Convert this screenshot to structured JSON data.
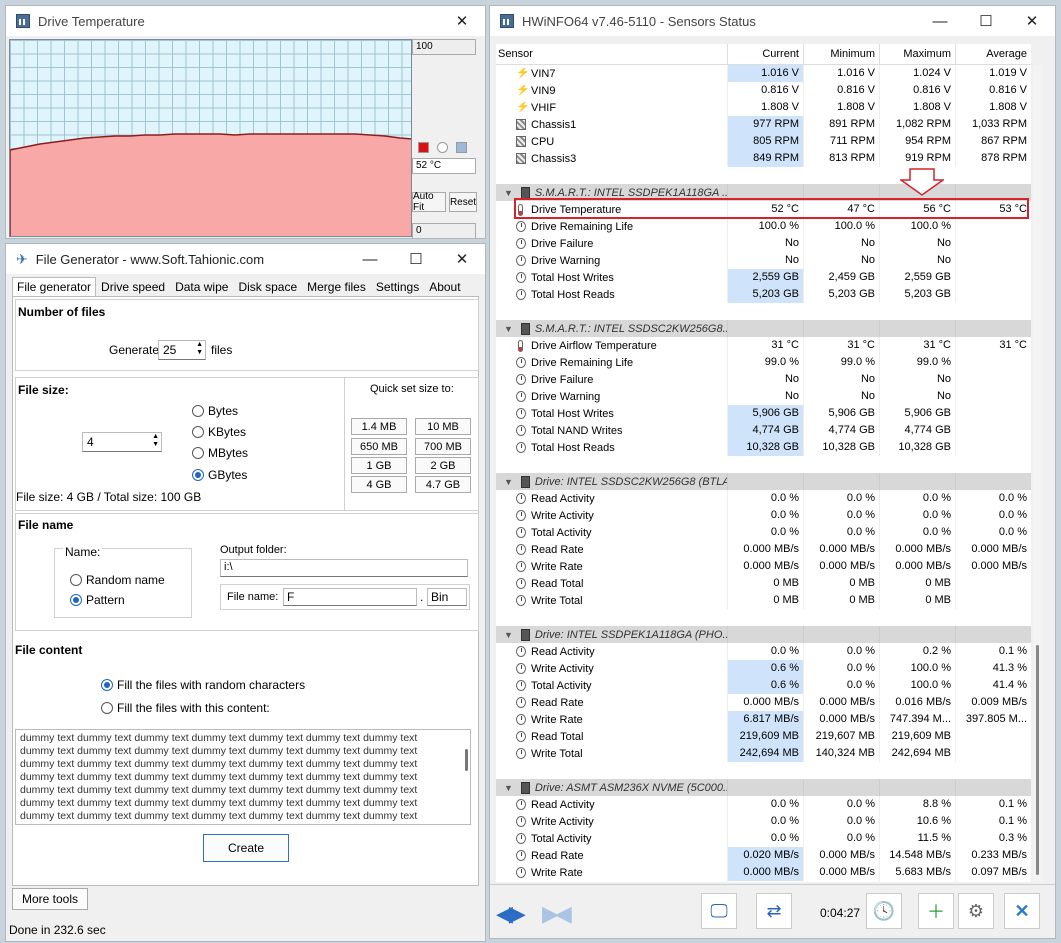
{
  "drive_temp_window": {
    "title": "Drive Temperature",
    "max_value": "100",
    "current_value": "52 °C",
    "min_value": "0",
    "auto_fit_label": "Auto Fit",
    "reset_label": "Reset",
    "fill_color": "#f9a8a8",
    "line_color": "#8b1d1d"
  },
  "file_generator": {
    "title": "File Generator  -  www.Soft.Tahionic.com",
    "tabs": [
      "File generator",
      "Drive speed",
      "Data wipe",
      "Disk space",
      "Merge files",
      "Settings",
      "About"
    ],
    "number_of_files": {
      "heading": "Number of files",
      "generate_label": "Generate",
      "count": "25",
      "files_label": "files"
    },
    "file_size": {
      "heading": "File size:",
      "value": "4",
      "units": [
        "Bytes",
        "KBytes",
        "MBytes",
        "GBytes"
      ],
      "selected_unit": "GBytes",
      "summary": "File size: 4 GB / Total size: 100 GB",
      "quick_set_label": "Quick set size to:",
      "quick_sizes": [
        "1.4 MB",
        "10 MB",
        "650 MB",
        "700 MB",
        "1 GB",
        "2 GB",
        "4 GB",
        "4.7 GB"
      ]
    },
    "file_name": {
      "heading": "File name",
      "name_label": "Name:",
      "random_name": "Random name",
      "pattern": "Pattern",
      "output_folder_label": "Output folder:",
      "output_folder": "i:\\",
      "file_name_label": "File name:",
      "file_name_value": "F",
      "ext_dot": ".",
      "extension": "Bin"
    },
    "file_content": {
      "heading": "File content",
      "option_random": "Fill the files with random characters",
      "option_content": "Fill the files with this content:",
      "content_lines": [
        "dummy text dummy text dummy text dummy text dummy text dummy text dummy text",
        "dummy text dummy text dummy text dummy text dummy text dummy text dummy text",
        "dummy text dummy text dummy text dummy text dummy text dummy text dummy text",
        "dummy text dummy text dummy text dummy text dummy text dummy text dummy text",
        "dummy text dummy text dummy text dummy text dummy text dummy text dummy text",
        "dummy text dummy text dummy text dummy text dummy text dummy text dummy text",
        "dummy text dummy text dummy text dummy text dummy text dummy text dummy text"
      ]
    },
    "create_label": "Create",
    "more_tools_label": "More tools",
    "status": "Done in 232.6 sec"
  },
  "hwinfo": {
    "title": "HWiNFO64 v7.46-5110 - Sensors Status",
    "columns": [
      "Sensor",
      "Current",
      "Minimum",
      "Maximum",
      "Average"
    ],
    "rows": [
      {
        "t": "s",
        "icon": "volt",
        "name": "VIN7",
        "v": [
          "1.016 V",
          "1.016 V",
          "1.024 V",
          "1.019 V"
        ],
        "hl": true
      },
      {
        "t": "s",
        "icon": "volt",
        "name": "VIN9",
        "v": [
          "0.816 V",
          "0.816 V",
          "0.816 V",
          "0.816 V"
        ],
        "hl": false
      },
      {
        "t": "s",
        "icon": "volt",
        "name": "VHIF",
        "v": [
          "1.808 V",
          "1.808 V",
          "1.808 V",
          "1.808 V"
        ],
        "hl": false
      },
      {
        "t": "s",
        "icon": "fan",
        "name": "Chassis1",
        "v": [
          "977 RPM",
          "891 RPM",
          "1,082 RPM",
          "1,033 RPM"
        ],
        "hl": true
      },
      {
        "t": "s",
        "icon": "fan",
        "name": "CPU",
        "v": [
          "805 RPM",
          "711 RPM",
          "954 RPM",
          "867 RPM"
        ],
        "hl": true
      },
      {
        "t": "s",
        "icon": "fan",
        "name": "Chassis3",
        "v": [
          "849 RPM",
          "813 RPM",
          "919 RPM",
          "878 RPM"
        ],
        "hl": true
      },
      {
        "t": "b"
      },
      {
        "t": "g",
        "name": "S.M.A.R.T.: INTEL SSDPEK1A118GA ..."
      },
      {
        "t": "s",
        "icon": "therm",
        "name": "Drive Temperature",
        "v": [
          "52 °C",
          "47 °C",
          "56 °C",
          "53 °C"
        ],
        "hl": false
      },
      {
        "t": "s",
        "icon": "clock",
        "name": "Drive Remaining Life",
        "v": [
          "100.0 %",
          "100.0 %",
          "100.0 %",
          ""
        ],
        "hl": false
      },
      {
        "t": "s",
        "icon": "clock",
        "name": "Drive Failure",
        "v": [
          "No",
          "No",
          "No",
          ""
        ],
        "hl": false
      },
      {
        "t": "s",
        "icon": "clock",
        "name": "Drive Warning",
        "v": [
          "No",
          "No",
          "No",
          ""
        ],
        "hl": false
      },
      {
        "t": "s",
        "icon": "clock",
        "name": "Total Host Writes",
        "v": [
          "2,559 GB",
          "2,459 GB",
          "2,559 GB",
          ""
        ],
        "hl": true
      },
      {
        "t": "s",
        "icon": "clock",
        "name": "Total Host Reads",
        "v": [
          "5,203 GB",
          "5,203 GB",
          "5,203 GB",
          ""
        ],
        "hl": true
      },
      {
        "t": "b"
      },
      {
        "t": "g",
        "name": "S.M.A.R.T.: INTEL SSDSC2KW256G8..."
      },
      {
        "t": "s",
        "icon": "therm",
        "name": "Drive Airflow Temperature",
        "v": [
          "31 °C",
          "31 °C",
          "31 °C",
          "31 °C"
        ],
        "hl": false
      },
      {
        "t": "s",
        "icon": "clock",
        "name": "Drive Remaining Life",
        "v": [
          "99.0 %",
          "99.0 %",
          "99.0 %",
          ""
        ],
        "hl": false
      },
      {
        "t": "s",
        "icon": "clock",
        "name": "Drive Failure",
        "v": [
          "No",
          "No",
          "No",
          ""
        ],
        "hl": false
      },
      {
        "t": "s",
        "icon": "clock",
        "name": "Drive Warning",
        "v": [
          "No",
          "No",
          "No",
          ""
        ],
        "hl": false
      },
      {
        "t": "s",
        "icon": "clock",
        "name": "Total Host Writes",
        "v": [
          "5,906 GB",
          "5,906 GB",
          "5,906 GB",
          ""
        ],
        "hl": true
      },
      {
        "t": "s",
        "icon": "clock",
        "name": "Total NAND Writes",
        "v": [
          "4,774 GB",
          "4,774 GB",
          "4,774 GB",
          ""
        ],
        "hl": true
      },
      {
        "t": "s",
        "icon": "clock",
        "name": "Total Host Reads",
        "v": [
          "10,328 GB",
          "10,328 GB",
          "10,328 GB",
          ""
        ],
        "hl": true
      },
      {
        "t": "b"
      },
      {
        "t": "g",
        "name": "Drive: INTEL SSDSC2KW256G8 (BTLA..."
      },
      {
        "t": "s",
        "icon": "clock",
        "name": "Read Activity",
        "v": [
          "0.0 %",
          "0.0 %",
          "0.0 %",
          "0.0 %"
        ],
        "hl": false
      },
      {
        "t": "s",
        "icon": "clock",
        "name": "Write Activity",
        "v": [
          "0.0 %",
          "0.0 %",
          "0.0 %",
          "0.0 %"
        ],
        "hl": false
      },
      {
        "t": "s",
        "icon": "clock",
        "name": "Total Activity",
        "v": [
          "0.0 %",
          "0.0 %",
          "0.0 %",
          "0.0 %"
        ],
        "hl": false
      },
      {
        "t": "s",
        "icon": "clock",
        "name": "Read Rate",
        "v": [
          "0.000 MB/s",
          "0.000 MB/s",
          "0.000 MB/s",
          "0.000 MB/s"
        ],
        "hl": false
      },
      {
        "t": "s",
        "icon": "clock",
        "name": "Write Rate",
        "v": [
          "0.000 MB/s",
          "0.000 MB/s",
          "0.000 MB/s",
          "0.000 MB/s"
        ],
        "hl": false
      },
      {
        "t": "s",
        "icon": "clock",
        "name": "Read Total",
        "v": [
          "0 MB",
          "0 MB",
          "0 MB",
          ""
        ],
        "hl": false
      },
      {
        "t": "s",
        "icon": "clock",
        "name": "Write Total",
        "v": [
          "0 MB",
          "0 MB",
          "0 MB",
          ""
        ],
        "hl": false
      },
      {
        "t": "b"
      },
      {
        "t": "g",
        "name": "Drive: INTEL SSDPEK1A118GA (PHO..."
      },
      {
        "t": "s",
        "icon": "clock",
        "name": "Read Activity",
        "v": [
          "0.0 %",
          "0.0 %",
          "0.2 %",
          "0.1 %"
        ],
        "hl": false
      },
      {
        "t": "s",
        "icon": "clock",
        "name": "Write Activity",
        "v": [
          "0.6 %",
          "0.0 %",
          "100.0 %",
          "41.3 %"
        ],
        "hl": true
      },
      {
        "t": "s",
        "icon": "clock",
        "name": "Total Activity",
        "v": [
          "0.6 %",
          "0.0 %",
          "100.0 %",
          "41.4 %"
        ],
        "hl": true
      },
      {
        "t": "s",
        "icon": "clock",
        "name": "Read Rate",
        "v": [
          "0.000 MB/s",
          "0.000 MB/s",
          "0.016 MB/s",
          "0.009 MB/s"
        ],
        "hl": false
      },
      {
        "t": "s",
        "icon": "clock",
        "name": "Write Rate",
        "v": [
          "6.817 MB/s",
          "0.000 MB/s",
          "747.394 M...",
          "397.805 M..."
        ],
        "hl": true
      },
      {
        "t": "s",
        "icon": "clock",
        "name": "Read Total",
        "v": [
          "219,609 MB",
          "219,607 MB",
          "219,609 MB",
          ""
        ],
        "hl": true
      },
      {
        "t": "s",
        "icon": "clock",
        "name": "Write Total",
        "v": [
          "242,694 MB",
          "140,324 MB",
          "242,694 MB",
          ""
        ],
        "hl": true
      },
      {
        "t": "b"
      },
      {
        "t": "g",
        "name": "Drive: ASMT ASM236X NVME (5C000..."
      },
      {
        "t": "s",
        "icon": "clock",
        "name": "Read Activity",
        "v": [
          "0.0 %",
          "0.0 %",
          "8.8 %",
          "0.1 %"
        ],
        "hl": false
      },
      {
        "t": "s",
        "icon": "clock",
        "name": "Write Activity",
        "v": [
          "0.0 %",
          "0.0 %",
          "10.6 %",
          "0.1 %"
        ],
        "hl": false
      },
      {
        "t": "s",
        "icon": "clock",
        "name": "Total Activity",
        "v": [
          "0.0 %",
          "0.0 %",
          "11.5 %",
          "0.3 %"
        ],
        "hl": false
      },
      {
        "t": "s",
        "icon": "clock",
        "name": "Read Rate",
        "v": [
          "0.020 MB/s",
          "0.000 MB/s",
          "14.548 MB/s",
          "0.233 MB/s"
        ],
        "hl": true
      },
      {
        "t": "s",
        "icon": "clock",
        "name": "Write Rate",
        "v": [
          "0.000 MB/s",
          "0.000 MB/s",
          "5.683 MB/s",
          "0.097 MB/s"
        ],
        "hl": true
      }
    ],
    "elapsed": "0:04:27"
  }
}
